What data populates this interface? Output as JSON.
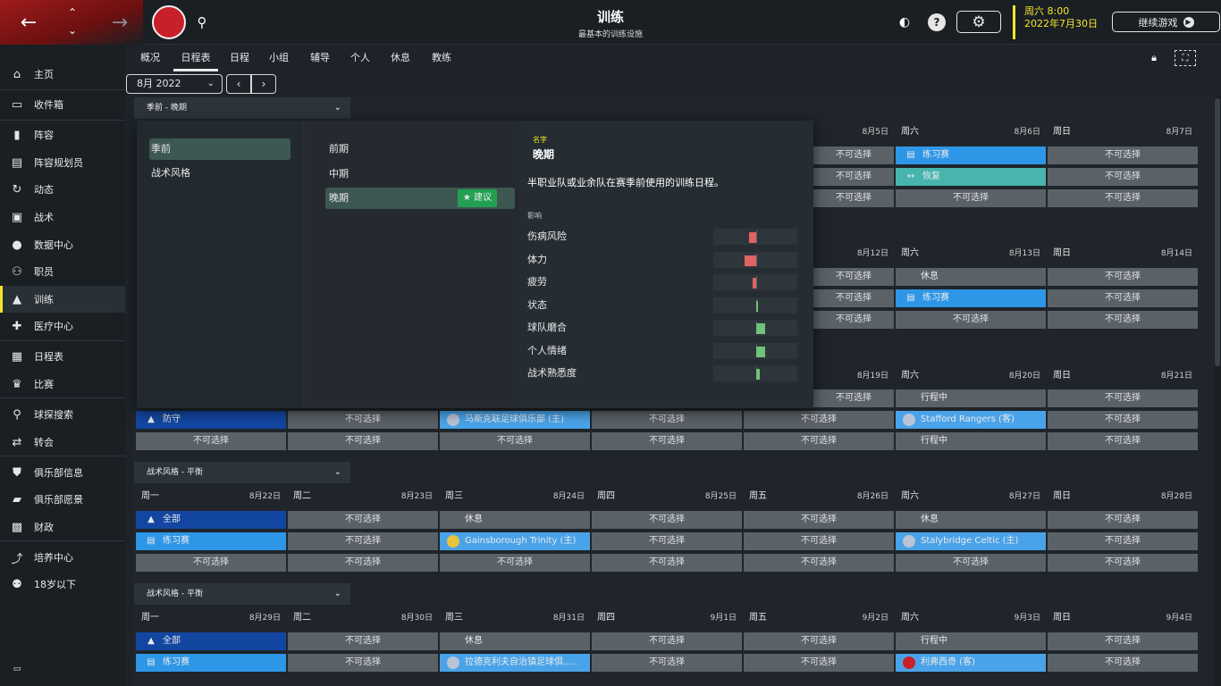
{
  "header": {
    "title": "训练",
    "subtitle": "最基本的训练设施",
    "date_line1": "周六 8:00",
    "date_line2": "2022年7月30日",
    "continue_label": "继续游戏"
  },
  "sidebar": {
    "items": [
      {
        "label": "主页",
        "icon": "home-icon"
      },
      {
        "label": "收件箱",
        "icon": "inbox-icon"
      },
      {
        "label": "阵容",
        "icon": "squad-icon"
      },
      {
        "label": "阵容规划员",
        "icon": "clipboard-icon"
      },
      {
        "label": "动态",
        "icon": "dynamics-icon"
      },
      {
        "label": "战术",
        "icon": "tactics-icon"
      },
      {
        "label": "数据中心",
        "icon": "data-icon"
      },
      {
        "label": "职员",
        "icon": "staff-icon"
      },
      {
        "label": "训练",
        "icon": "training-icon"
      },
      {
        "label": "医疗中心",
        "icon": "medical-icon"
      },
      {
        "label": "日程表",
        "icon": "calendar-icon"
      },
      {
        "label": "比赛",
        "icon": "trophy-icon"
      },
      {
        "label": "球探搜索",
        "icon": "search-icon"
      },
      {
        "label": "转会",
        "icon": "transfer-icon"
      },
      {
        "label": "俱乐部信息",
        "icon": "shield-icon"
      },
      {
        "label": "俱乐部愿景",
        "icon": "vision-icon"
      },
      {
        "label": "财政",
        "icon": "finance-icon"
      },
      {
        "label": "培养中心",
        "icon": "development-icon"
      },
      {
        "label": "18岁以下",
        "icon": "u18-icon"
      }
    ]
  },
  "tabs": [
    "概况",
    "日程表",
    "日程",
    "小组",
    "辅导",
    "个人",
    "休息",
    "教练"
  ],
  "month": "8月 2022",
  "na": "不可选择",
  "popup": {
    "categories": [
      "季前",
      "战术风格"
    ],
    "options": [
      "前期",
      "中期",
      "晚期"
    ],
    "suggest": "建议",
    "name_label": "名字",
    "name": "晚期",
    "desc": "半职业队或业余队在赛季前使用的训练日程。",
    "impact_label": "影响",
    "impacts": [
      {
        "label": "伤病风险",
        "value": 0.18,
        "color": "#e06363"
      },
      {
        "label": "体力",
        "value": 0.3,
        "color": "#e06363"
      },
      {
        "label": "疲劳",
        "value": 0.08,
        "color": "#e06363"
      },
      {
        "label": "状态",
        "value": 0.02,
        "color": "#6fc27a"
      },
      {
        "label": "球队磨合",
        "value": 0.22,
        "color": "#6fc27a"
      },
      {
        "label": "个人情绪",
        "value": 0.22,
        "color": "#6fc27a"
      },
      {
        "label": "战术熟悉度",
        "value": 0.08,
        "color": "#6fc27a"
      }
    ]
  },
  "sections": [
    {
      "title": "季前 - 晚期",
      "days": [
        {
          "d": "周六",
          "date": "8月6日"
        },
        {
          "d": "周日",
          "date": "8月7日"
        }
      ],
      "partial_date": "8月5日",
      "rows": [
        [
          "练习赛",
          "不可选择"
        ],
        [
          "恢复",
          "不可选择"
        ],
        [
          "不可选择",
          "不可选择"
        ]
      ]
    },
    {
      "days": [
        {
          "d": "周六",
          "date": "8月13日"
        },
        {
          "d": "周日",
          "date": "8月14日"
        }
      ],
      "partial_date": "8月12日",
      "rows": [
        [
          "休息",
          "不可选择"
        ],
        [
          "练习赛",
          "不可选择"
        ],
        [
          "不可选择",
          "不可选择"
        ]
      ]
    },
    {
      "days": [
        {
          "d": "周六",
          "date": "8月20日"
        },
        {
          "d": "周日",
          "date": "8月21日"
        }
      ],
      "partial_date": "8月19日",
      "rows": [
        [
          "行程中",
          "不可选择"
        ],
        [
          "Stafford Rangers (客)",
          "不可选择"
        ],
        [
          "行程中",
          "不可选择"
        ]
      ],
      "row2_full": [
        "防守",
        "不可选择",
        "马斯克联足球俱乐部 (主)",
        "不可选择",
        "不可选择"
      ],
      "row3_full": [
        "不可选择",
        "不可选择",
        "不可选择",
        "不可选择",
        "不可选择"
      ]
    },
    {
      "title": "战术风格 - 平衡",
      "days": [
        {
          "d": "周一",
          "date": "8月22日"
        },
        {
          "d": "周二",
          "date": "8月23日"
        },
        {
          "d": "周三",
          "date": "8月24日"
        },
        {
          "d": "周四",
          "date": "8月25日"
        },
        {
          "d": "周五",
          "date": "8月26日"
        },
        {
          "d": "周六",
          "date": "8月27日"
        },
        {
          "d": "周日",
          "date": "8月28日"
        }
      ],
      "rows": [
        [
          "全部",
          "不可选择",
          "休息",
          "不可选择",
          "不可选择",
          "休息",
          "不可选择"
        ],
        [
          "练习赛",
          "不可选择",
          "Gainsborough Trinity (主)",
          "不可选择",
          "不可选择",
          "Stalybridge Celtic (主)",
          "不可选择"
        ],
        [
          "不可选择",
          "不可选择",
          "不可选择",
          "不可选择",
          "不可选择",
          "不可选择",
          "不可选择"
        ]
      ]
    },
    {
      "title": "战术风格 - 平衡",
      "days": [
        {
          "d": "周一",
          "date": "8月29日"
        },
        {
          "d": "周二",
          "date": "8月30日"
        },
        {
          "d": "周三",
          "date": "8月31日"
        },
        {
          "d": "周四",
          "date": "9月1日"
        },
        {
          "d": "周五",
          "date": "9月2日"
        },
        {
          "d": "周六",
          "date": "9月3日"
        },
        {
          "d": "周日",
          "date": "9月4日"
        }
      ],
      "rows": [
        [
          "全部",
          "不可选择",
          "休息",
          "不可选择",
          "不可选择",
          "行程中",
          "不可选择"
        ],
        [
          "练习赛",
          "不可选择",
          "拉德克利夫自治镇足球俱.....",
          "不可选择",
          "不可选择",
          "利弗西奇 (客)",
          "不可选择"
        ]
      ]
    }
  ]
}
